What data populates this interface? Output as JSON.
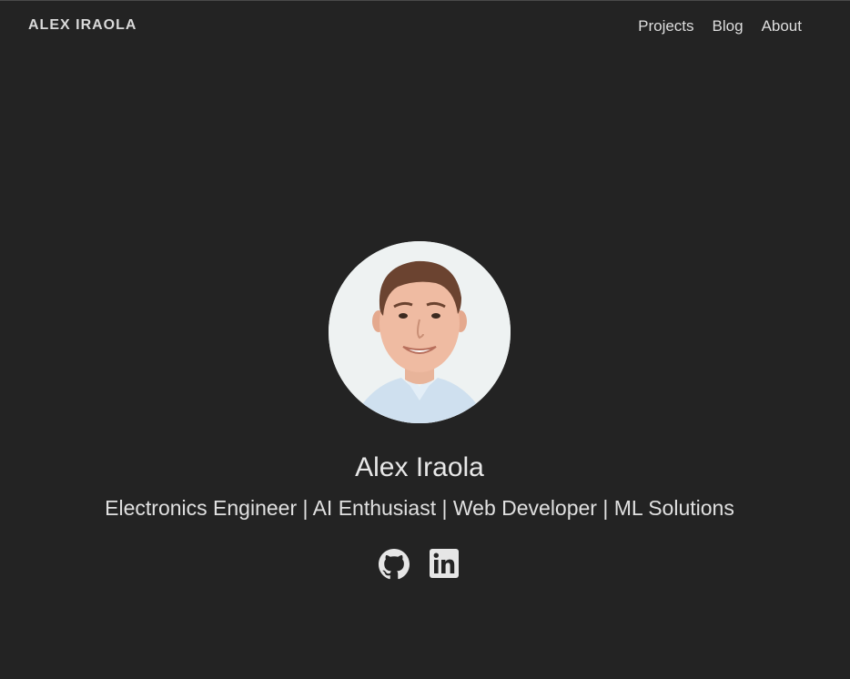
{
  "header": {
    "brand": "ALEX IRAOLA",
    "nav": [
      {
        "label": "Projects"
      },
      {
        "label": "Blog"
      },
      {
        "label": "About"
      }
    ]
  },
  "profile": {
    "name": "Alex Iraola",
    "tagline": "Electronics Engineer | AI Enthusiast | Web Developer | ML Solutions"
  },
  "socials": [
    {
      "icon": "github-icon"
    },
    {
      "icon": "linkedin-icon"
    }
  ],
  "colors": {
    "background": "#232323",
    "text": "#e6e6e6",
    "avatar_bg": "#eef2f2"
  }
}
